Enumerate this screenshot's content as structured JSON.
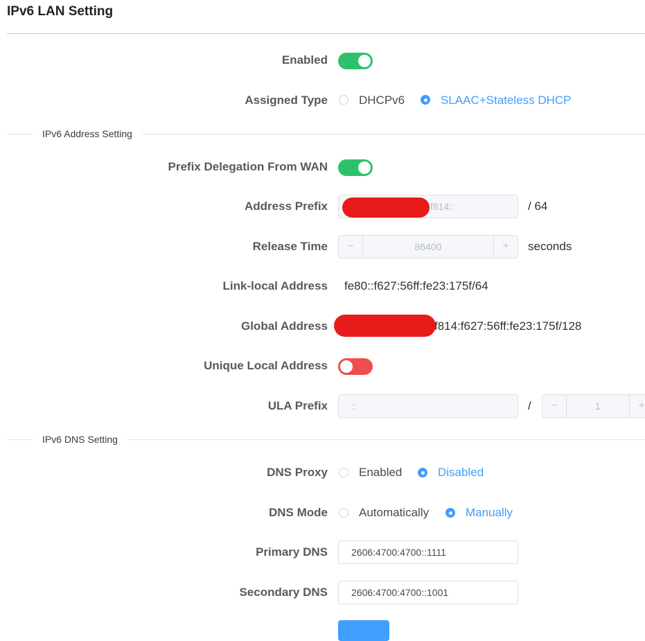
{
  "page": {
    "title": "IPv6 LAN Setting"
  },
  "enabled": {
    "label": "Enabled",
    "value": true
  },
  "assigned_type": {
    "label": "Assigned Type",
    "options": [
      "DHCPv6",
      "SLAAC+Stateless DHCP"
    ],
    "selected": "SLAAC+Stateless DHCP"
  },
  "address_section": {
    "title": "IPv6 Address Setting"
  },
  "prefix_delegation": {
    "label": "Prefix Delegation From WAN",
    "value": true
  },
  "address_prefix": {
    "label": "Address Prefix",
    "value": "f814::",
    "suffix": "/ 64"
  },
  "release_time": {
    "label": "Release Time",
    "value": "86400",
    "unit": "seconds",
    "minus": "−",
    "plus": "+"
  },
  "link_local": {
    "label": "Link-local Address",
    "value": "fe80::f627:56ff:fe23:175f/64"
  },
  "global_address": {
    "label": "Global Address",
    "value": "f814:f627:56ff:fe23:175f/128"
  },
  "unique_local": {
    "label": "Unique Local Address",
    "value": false
  },
  "ula_prefix": {
    "label": "ULA Prefix",
    "value": "::",
    "separator": "/",
    "length": "1",
    "minus": "−",
    "plus": "+"
  },
  "dns_section": {
    "title": "IPv6 DNS Setting"
  },
  "dns_proxy": {
    "label": "DNS Proxy",
    "options": [
      "Enabled",
      "Disabled"
    ],
    "selected": "Disabled"
  },
  "dns_mode": {
    "label": "DNS Mode",
    "options": [
      "Automatically",
      "Manually"
    ],
    "selected": "Manually"
  },
  "primary_dns": {
    "label": "Primary DNS",
    "value": "2606:4700:4700::1111"
  },
  "secondary_dns": {
    "label": "Secondary DNS",
    "value": "2606:4700:4700::1001"
  },
  "colors": {
    "accent": "#409eff",
    "switch_on": "#2ec16b",
    "switch_off": "#f04d4e"
  }
}
